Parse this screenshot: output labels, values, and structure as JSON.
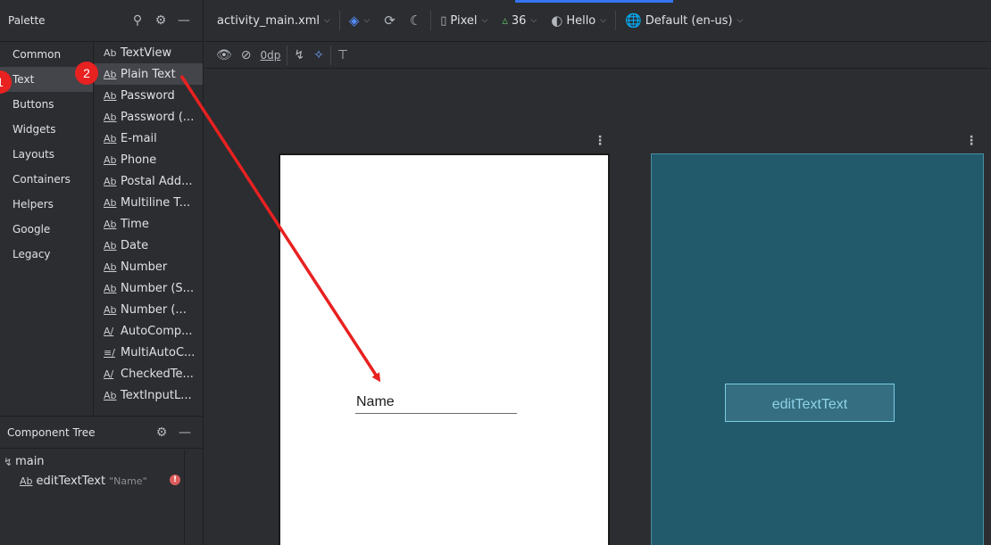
{
  "palette": {
    "title": "Palette",
    "categories": [
      "Common",
      "Text",
      "Buttons",
      "Widgets",
      "Layouts",
      "Containers",
      "Helpers",
      "Google",
      "Legacy"
    ],
    "items": [
      {
        "glyph": "Ab",
        "label": "TextView"
      },
      {
        "glyph": "Ab",
        "label": "Plain Text"
      },
      {
        "glyph": "Ab",
        "label": "Password"
      },
      {
        "glyph": "Ab",
        "label": "Password (..."
      },
      {
        "glyph": "Ab",
        "label": "E-mail"
      },
      {
        "glyph": "Ab",
        "label": "Phone"
      },
      {
        "glyph": "Ab",
        "label": "Postal Add..."
      },
      {
        "glyph": "Ab",
        "label": "Multiline T..."
      },
      {
        "glyph": "Ab",
        "label": "Time"
      },
      {
        "glyph": "Ab",
        "label": "Date"
      },
      {
        "glyph": "Ab",
        "label": "Number"
      },
      {
        "glyph": "Ab",
        "label": "Number (S..."
      },
      {
        "glyph": "Ab",
        "label": "Number (..."
      },
      {
        "glyph": "A/",
        "label": "AutoComp..."
      },
      {
        "glyph": "≡/",
        "label": "MultiAutoC..."
      },
      {
        "glyph": "A/",
        "label": "CheckedTe..."
      },
      {
        "glyph": "Ab",
        "label": "TextInputL..."
      }
    ]
  },
  "component_tree": {
    "title": "Component Tree",
    "root": "main",
    "child_glyph": "Ab",
    "child_label": "editTextText",
    "child_hint": "\"Name\""
  },
  "toolbar": {
    "file": "activity_main.xml",
    "device": "Pixel",
    "api": "36",
    "theme": "Hello",
    "locale": "Default (en-us)",
    "margin": "0dp"
  },
  "design": {
    "name_text": "Name",
    "blueprint_label": "editTextText"
  },
  "annotations": {
    "badge1": "1",
    "badge2": "2"
  },
  "colors": {
    "accent": "#3574f0",
    "annotation": "#e82121",
    "blueprint_bg": "#225a6c",
    "error": "#db5c5c"
  }
}
